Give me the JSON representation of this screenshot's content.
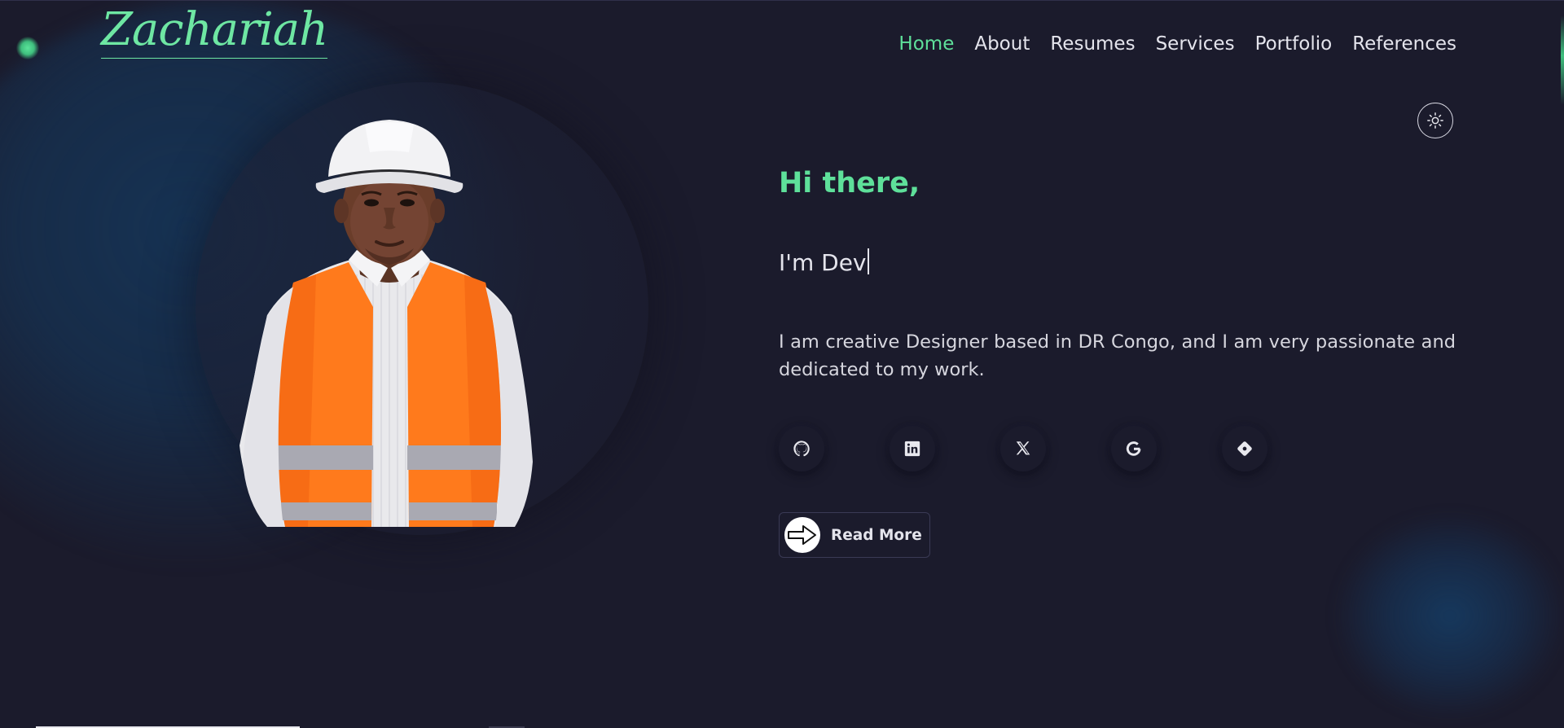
{
  "brand": {
    "logo_text": "Zachariah",
    "accent": "#5ee09a",
    "background": "#1b1b2c"
  },
  "nav": {
    "items": [
      {
        "label": "Home",
        "active": true
      },
      {
        "label": "About",
        "active": false
      },
      {
        "label": "Resumes",
        "active": false
      },
      {
        "label": "Services",
        "active": false
      },
      {
        "label": "Portfolio",
        "active": false
      },
      {
        "label": "References",
        "active": false
      }
    ]
  },
  "theme_toggle": {
    "icon": "sun-icon"
  },
  "hero": {
    "greeting": "Hi there,",
    "typed_text": "I'm Dev",
    "bio": "I am creative Designer based in DR Congo, and I am very passionate and dedicated to my work.",
    "socials": [
      {
        "icon": "github-icon"
      },
      {
        "icon": "linkedin-icon"
      },
      {
        "icon": "x-icon"
      },
      {
        "icon": "google-icon"
      },
      {
        "icon": "git-icon"
      }
    ],
    "read_more_label": "Read More"
  }
}
